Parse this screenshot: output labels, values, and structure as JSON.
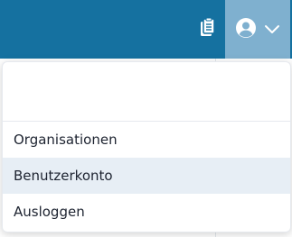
{
  "topbar": {
    "color": "#1571a0",
    "active_color": "#7fb0cf",
    "icons": [
      "clipboard-icon",
      "user-circle-icon",
      "chevron-down-icon"
    ]
  },
  "menu": {
    "items": [
      {
        "label": "Organisationen"
      },
      {
        "label": "Benutzerkonto",
        "highlighted": true
      },
      {
        "label": "Ausloggen"
      }
    ]
  }
}
